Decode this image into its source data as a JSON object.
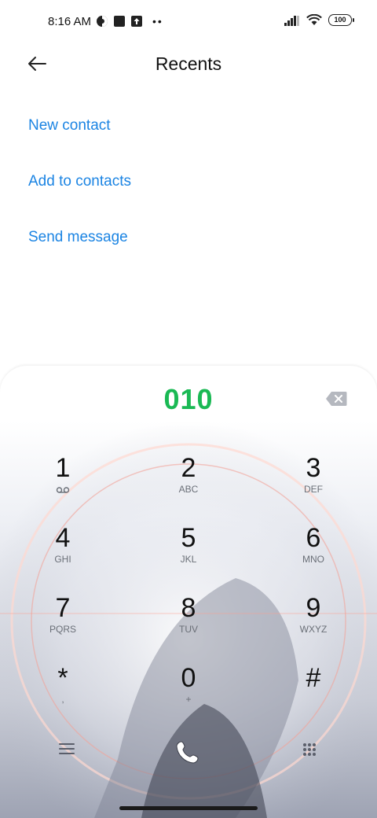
{
  "status": {
    "time": "8:16 AM",
    "battery": "100"
  },
  "header": {
    "title": "Recents"
  },
  "menu": {
    "items": [
      {
        "label": "New contact"
      },
      {
        "label": "Add to contacts"
      },
      {
        "label": "Send message"
      }
    ]
  },
  "dialer": {
    "number": "010",
    "keys": [
      {
        "digit": "1",
        "letters": ""
      },
      {
        "digit": "2",
        "letters": "ABC"
      },
      {
        "digit": "3",
        "letters": "DEF"
      },
      {
        "digit": "4",
        "letters": "GHI"
      },
      {
        "digit": "5",
        "letters": "JKL"
      },
      {
        "digit": "6",
        "letters": "MNO"
      },
      {
        "digit": "7",
        "letters": "PQRS"
      },
      {
        "digit": "8",
        "letters": "TUV"
      },
      {
        "digit": "9",
        "letters": "WXYZ"
      },
      {
        "digit": "*",
        "letters": ","
      },
      {
        "digit": "0",
        "letters": "+"
      },
      {
        "digit": "#",
        "letters": ""
      }
    ]
  },
  "colors": {
    "link": "#1b84e3",
    "number": "#1ab954"
  }
}
